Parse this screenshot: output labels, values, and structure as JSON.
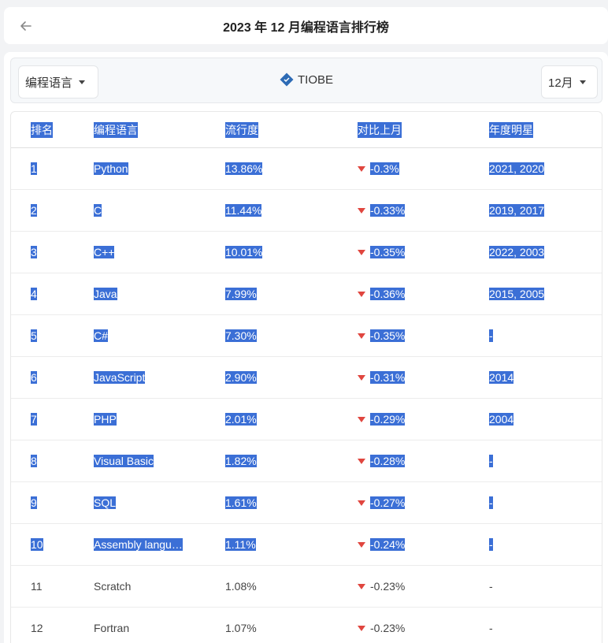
{
  "header": {
    "title": "2023 年 12 月编程语言排行榜"
  },
  "toolbar": {
    "language_select": "编程语言",
    "brand": "TIOBE",
    "month_select": "12月"
  },
  "table": {
    "columns": [
      "排名",
      "编程语言",
      "流行度",
      "对比上月",
      "年度明星"
    ],
    "rows": [
      {
        "rank": "1",
        "lang": "Python",
        "pop": "13.86%",
        "change": "-0.3%",
        "star": "2021, 2020",
        "selected": true
      },
      {
        "rank": "2",
        "lang": "C",
        "pop": "11.44%",
        "change": "-0.33%",
        "star": "2019, 2017",
        "selected": true
      },
      {
        "rank": "3",
        "lang": "C++",
        "pop": "10.01%",
        "change": "-0.35%",
        "star": "2022, 2003",
        "selected": true
      },
      {
        "rank": "4",
        "lang": "Java",
        "pop": "7.99%",
        "change": "-0.36%",
        "star": "2015, 2005",
        "selected": true
      },
      {
        "rank": "5",
        "lang": "C#",
        "pop": "7.30%",
        "change": "-0.35%",
        "star": "-",
        "selected": true
      },
      {
        "rank": "6",
        "lang": "JavaScript",
        "pop": "2.90%",
        "change": "-0.31%",
        "star": "2014",
        "selected": true
      },
      {
        "rank": "7",
        "lang": "PHP",
        "pop": "2.01%",
        "change": "-0.29%",
        "star": "2004",
        "selected": true
      },
      {
        "rank": "8",
        "lang": "Visual Basic",
        "pop": "1.82%",
        "change": "-0.28%",
        "star": "-",
        "selected": true
      },
      {
        "rank": "9",
        "lang": "SQL",
        "pop": "1.61%",
        "change": "-0.27%",
        "star": "-",
        "selected": true
      },
      {
        "rank": "10",
        "lang": "Assembly langu…",
        "pop": "1.11%",
        "change": "-0.24%",
        "star": "-",
        "selected": true
      },
      {
        "rank": "11",
        "lang": "Scratch",
        "pop": "1.08%",
        "change": "-0.23%",
        "star": "-",
        "selected": false
      },
      {
        "rank": "12",
        "lang": "Fortran",
        "pop": "1.07%",
        "change": "-0.23%",
        "star": "-",
        "selected": false
      }
    ]
  },
  "colors": {
    "selection": "#3b6fd6",
    "down_arrow": "#e0463f"
  },
  "icons": {
    "back": "arrow-left-icon",
    "caret": "caret-down-icon",
    "brand": "tiobe-logo-icon",
    "trend": "triangle-down-icon"
  }
}
